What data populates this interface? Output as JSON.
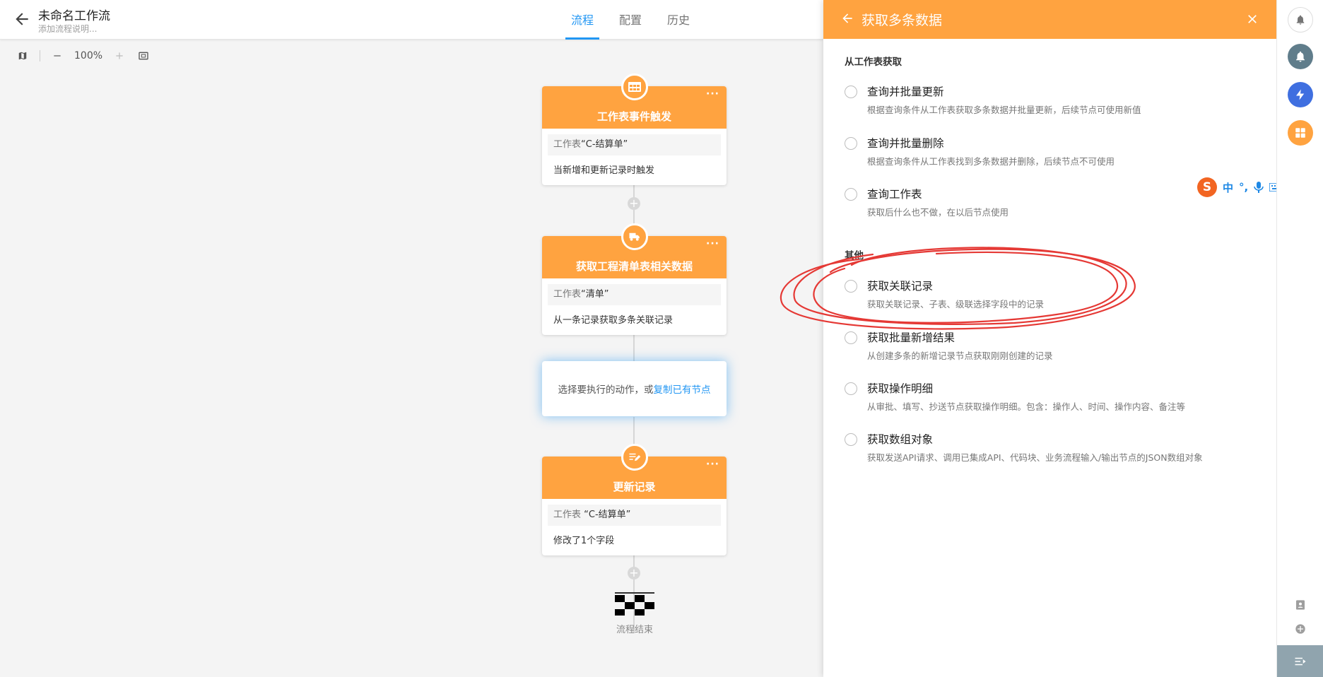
{
  "header": {
    "title": "未命名工作流",
    "description": "添加流程说明...",
    "tabs": [
      {
        "label": "流程"
      },
      {
        "label": "配置"
      },
      {
        "label": "历史"
      }
    ]
  },
  "toolbar": {
    "zoom": "100%"
  },
  "nodes": [
    {
      "title": "工作表事件触发",
      "sheet_label": "工作表",
      "sheet_name": "“C-结算单”",
      "desc": "当新增和更新记录时触发",
      "more": "···"
    },
    {
      "title": "获取工程清单表相关数据",
      "sheet_label": "工作表",
      "sheet_name": "“清单”",
      "desc": "从一条记录获取多条关联记录",
      "more": "···"
    },
    {
      "title": "更新记录",
      "sheet_label": "工作表",
      "sheet_name": " “C-结算单”",
      "desc": "修改了1个字段",
      "more": "···"
    }
  ],
  "select_action": {
    "text": "选择要执行的动作，或",
    "link": "复制已有节点"
  },
  "end_label": "流程结束",
  "panel": {
    "title": "获取多条数据",
    "section1": "从工作表获取",
    "section2": "其他",
    "options": [
      {
        "label": "查询并批量更新",
        "sub": "根据查询条件从工作表获取多条数据并批量更新，后续节点可使用新值"
      },
      {
        "label": "查询并批量删除",
        "sub": "根据查询条件从工作表找到多条数据并删除，后续节点不可使用"
      },
      {
        "label": "查询工作表",
        "sub": "获取后什么也不做，在以后节点使用"
      },
      {
        "label": "获取关联记录",
        "sub": "获取关联记录、子表、级联选择字段中的记录"
      },
      {
        "label": "获取批量新增结果",
        "sub": "从创建多条的新增记录节点获取刚刚创建的记录"
      },
      {
        "label": "获取操作明细",
        "sub": "从审批、填写、抄送节点获取操作明细。包含：操作人、时间、操作内容、备注等"
      },
      {
        "label": "获取数组对象",
        "sub": "获取发送API请求、调用已集成API、代码块、业务流程输入/输出节点的JSON数组对象"
      }
    ]
  },
  "ime": {
    "logo": "S",
    "mode": "中",
    "punct": "°,"
  },
  "colors": {
    "accent": "#ffa340",
    "primary": "#2196f3",
    "annotation": "#e53935"
  }
}
